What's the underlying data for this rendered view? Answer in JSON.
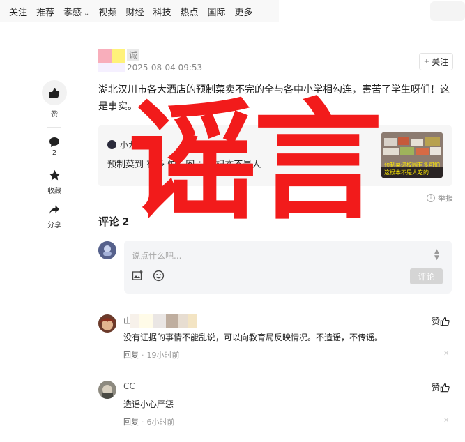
{
  "nav": {
    "items": [
      "关注",
      "推荐",
      "孝感",
      "视频",
      "财经",
      "科技",
      "热点",
      "国际",
      "更多"
    ]
  },
  "post": {
    "author": "诚",
    "time": "2025-08-04 09:53",
    "follow_label": "关注",
    "text": "湖北汉川市各大酒店的预制菜卖不完的全与各中小学相勾连，害苦了学生呀们！这是事实。",
    "quote": {
      "author": "小九看分享",
      "text": "预制菜到  有多   怕？网   ：这根本不是人",
      "thumb_caption_1": "预制菜进校园有多可怕",
      "thumb_caption_2": "这根本不是人吃的"
    },
    "report_label": "举报"
  },
  "rail": {
    "like_label": "赞",
    "comment_count": "2",
    "favorite_label": "收藏",
    "share_label": "分享"
  },
  "stamp": "谣言",
  "comments": {
    "title": "评论",
    "count": "2",
    "input_placeholder": "说点什么吧...",
    "submit_label": "评论",
    "items": [
      {
        "name": "山",
        "text": "没有证据的事情不能乱说，可以向教育局反映情况。不造谣，不传谣。",
        "reply_label": "回复",
        "time": "19小时前",
        "like_label": "赞"
      },
      {
        "name": "CC",
        "text": "造谣小心严惩",
        "reply_label": "回复",
        "time": "6小时前",
        "like_label": "赞"
      }
    ]
  },
  "colors": {
    "stamp_red": "#f21b1b",
    "nav_bg": "#f8f8f8",
    "card_bg": "#f6f6f6",
    "input_bg": "#f4f5f7"
  }
}
